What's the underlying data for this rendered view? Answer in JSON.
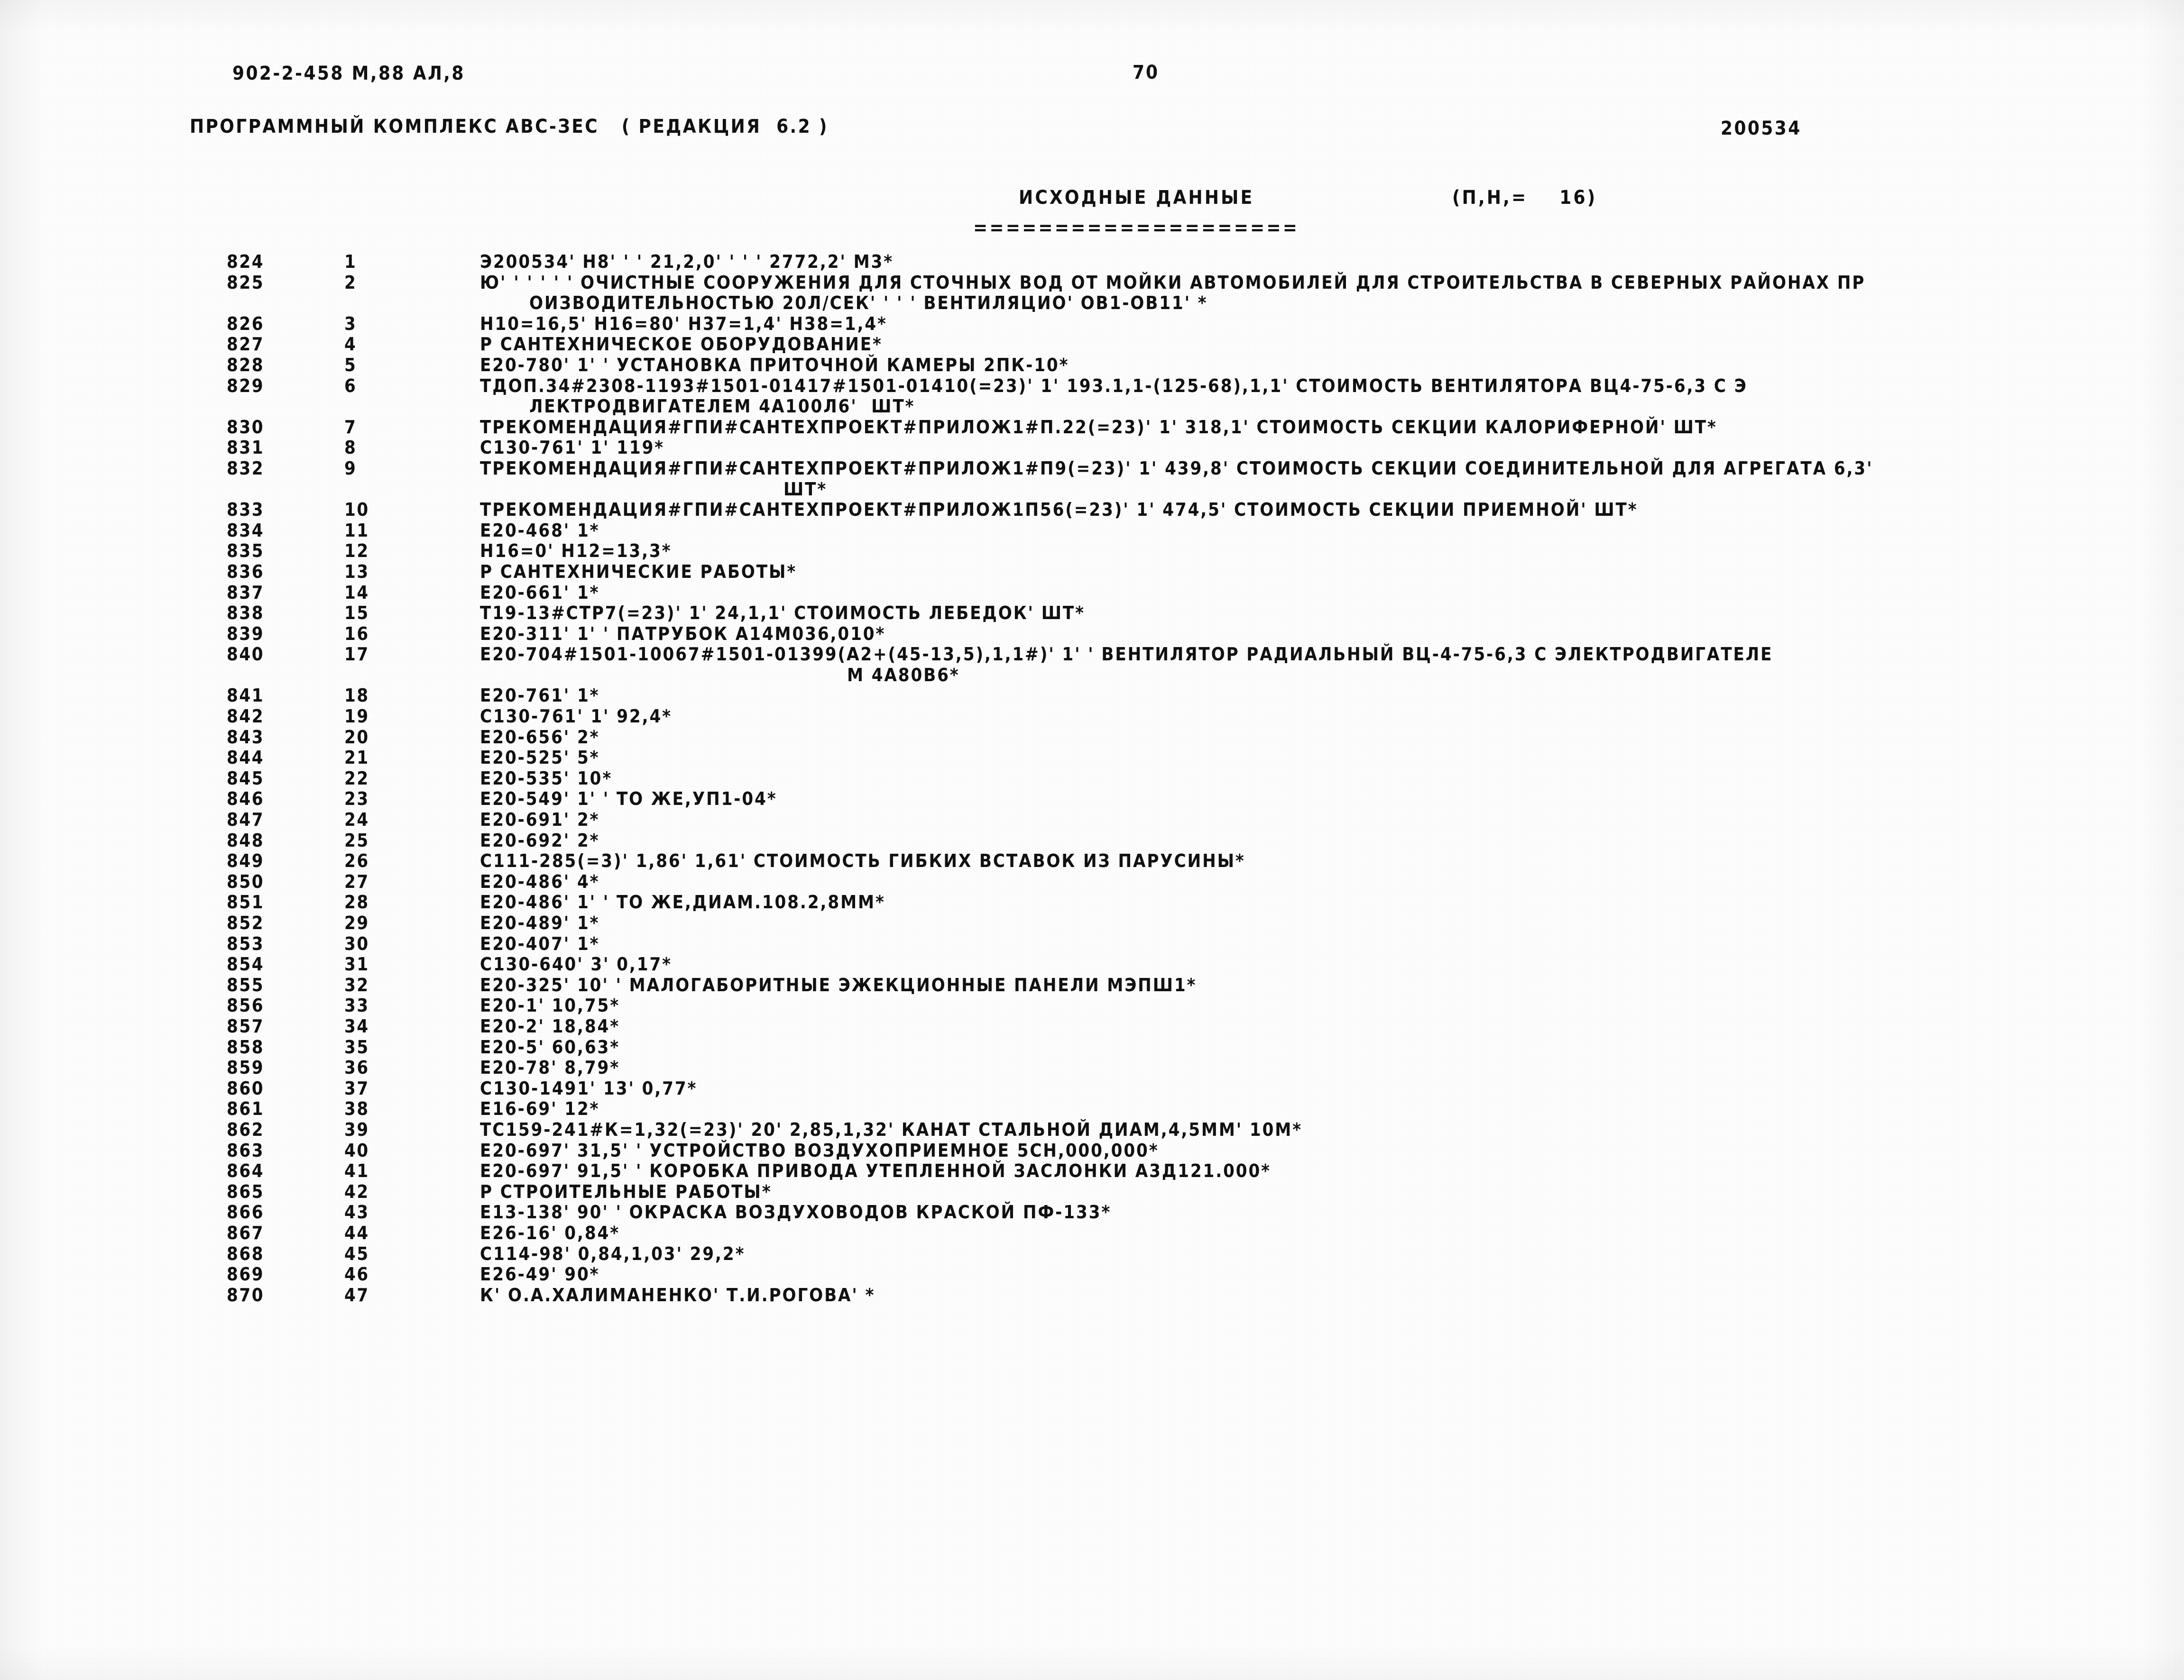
{
  "header": {
    "doc_code": "902-2-458 М,88 АЛ,8",
    "page_number": "70",
    "program_line": "ПРОГРАММНЫЙ КОМПЛЕКС АВС-ЗЕС   ( РЕДАКЦИЯ  6.2 )",
    "sheet_code": "200534"
  },
  "title": {
    "main": "ИСХОДНЫЕ ДАННЫЕ",
    "pn": "(П,Н,=    16)",
    "rule": "===================="
  },
  "listing": {
    "rows": [
      {
        "rec": "824",
        "seq": "1",
        "text": "Э200534' Н8' ' ' 21,2,0' ' ' ' 2772,2' М3*"
      },
      {
        "rec": "825",
        "seq": "2",
        "text": "Ю' ' ' ' ' ' ОЧИСТНЫЕ СООРУЖЕНИЯ ДЛЯ СТОЧНЫХ ВОД ОТ МОЙКИ АВТОМОБИЛЕЙ ДЛЯ СТРОИТЕЛЬСТВА В СЕВЕРНЫХ РАЙОНАХ ПР",
        "cont": "ОИЗВОДИТЕЛЬНОСТЬЮ 20Л/СЕК' ' ' ' ВЕНТИЛЯЦИО' ОВ1-ОВ11' *",
        "cont_indent": "ind-1"
      },
      {
        "rec": "826",
        "seq": "3",
        "text": "Н10=16,5' Н16=80' Н37=1,4' Н38=1,4*"
      },
      {
        "rec": "827",
        "seq": "4",
        "text": "Р САНТЕХНИЧЕСКОЕ ОБОРУДОВАНИЕ*"
      },
      {
        "rec": "828",
        "seq": "5",
        "text": "Е20-780' 1' ' УСТАНОВКА ПРИТОЧНОЙ КАМЕРЫ 2ПК-10*"
      },
      {
        "rec": "829",
        "seq": "6",
        "text": "ТДОП.34#2308-1193#1501-01417#1501-01410(=23)' 1' 193.1,1-(125-68),1,1' СТОИМОСТЬ ВЕНТИЛЯТОРА ВЦ4-75-6,3 С Э",
        "cont": "ЛЕКТРОДВИГАТЕЛЕМ 4А100Л6'  ШТ*",
        "cont_indent": "ind-1"
      },
      {
        "rec": "830",
        "seq": "7",
        "text": "ТРЕКОМЕНДАЦИЯ#ГПИ#САНТЕХПРОЕКТ#ПРИЛОЖ1#П.22(=23)' 1' 318,1' СТОИМОСТЬ СЕКЦИИ КАЛОРИФЕРНОЙ' ШТ*"
      },
      {
        "rec": "831",
        "seq": "8",
        "text": "С130-761' 1' 119*"
      },
      {
        "rec": "832",
        "seq": "9",
        "text": "ТРЕКОМЕНДАЦИЯ#ГПИ#САНТЕХПРОЕКТ#ПРИЛОЖ1#П9(=23)' 1' 439,8' СТОИМОСТЬ СЕКЦИИ СОЕДИНИТЕЛЬНОЙ ДЛЯ АГРЕГАТА 6,3'",
        "cont": "ШТ*",
        "cont_indent": "ind-2"
      },
      {
        "rec": "833",
        "seq": "10",
        "text": "ТРЕКОМЕНДАЦИЯ#ГПИ#САНТЕХПРОЕКТ#ПРИЛОЖ1П56(=23)' 1' 474,5' СТОИМОСТЬ СЕКЦИИ ПРИЕМНОЙ' ШТ*"
      },
      {
        "rec": "834",
        "seq": "11",
        "text": "Е20-468' 1*"
      },
      {
        "rec": "835",
        "seq": "12",
        "text": "Н16=0' Н12=13,3*"
      },
      {
        "rec": "836",
        "seq": "13",
        "text": "Р САНТЕХНИЧЕСКИЕ РАБОТЫ*"
      },
      {
        "rec": "837",
        "seq": "14",
        "text": "Е20-661' 1*"
      },
      {
        "rec": "838",
        "seq": "15",
        "text": "Т19-13#СТР7(=23)' 1' 24,1,1' СТОИМОСТЬ ЛЕБЕДОК' ШТ*"
      },
      {
        "rec": "839",
        "seq": "16",
        "text": "Е20-311' 1' ' ПАТРУБОК А14М036,010*"
      },
      {
        "rec": "840",
        "seq": "17",
        "text": "Е20-704#1501-10067#1501-01399(А2+(45-13,5),1,1#)' 1' ' ВЕНТИЛЯТОР РАДИАЛЬНЫЙ ВЦ-4-75-6,3 С ЭЛЕКТРОДВИГАТЕЛЕ",
        "cont": "М 4А80В6*",
        "cont_indent": "ind-3"
      },
      {
        "rec": "841",
        "seq": "18",
        "text": "Е20-761' 1*"
      },
      {
        "rec": "842",
        "seq": "19",
        "text": "С130-761' 1' 92,4*"
      },
      {
        "rec": "843",
        "seq": "20",
        "text": "Е20-656' 2*"
      },
      {
        "rec": "844",
        "seq": "21",
        "text": "Е20-525' 5*"
      },
      {
        "rec": "845",
        "seq": "22",
        "text": "Е20-535' 10*"
      },
      {
        "rec": "846",
        "seq": "23",
        "text": "Е20-549' 1' ' ТО ЖЕ,УП1-04*"
      },
      {
        "rec": "847",
        "seq": "24",
        "text": "Е20-691' 2*"
      },
      {
        "rec": "848",
        "seq": "25",
        "text": "Е20-692' 2*"
      },
      {
        "rec": "849",
        "seq": "26",
        "text": "С111-285(=3)' 1,86' 1,61' СТОИМОСТЬ ГИБКИХ ВСТАВОК ИЗ ПАРУСИНЫ*"
      },
      {
        "rec": "850",
        "seq": "27",
        "text": "Е20-486' 4*"
      },
      {
        "rec": "851",
        "seq": "28",
        "text": "Е20-486' 1' ' ТО ЖЕ,ДИАМ.108.2,8ММ*"
      },
      {
        "rec": "852",
        "seq": "29",
        "text": "Е20-489' 1*"
      },
      {
        "rec": "853",
        "seq": "30",
        "text": "Е20-407' 1*"
      },
      {
        "rec": "854",
        "seq": "31",
        "text": "С130-640' 3' 0,17*"
      },
      {
        "rec": "855",
        "seq": "32",
        "text": "Е20-325' 10' ' МАЛОГАБОРИТНЫЕ ЭЖЕКЦИОННЫЕ ПАНЕЛИ МЭПШ1*"
      },
      {
        "rec": "856",
        "seq": "33",
        "text": "Е20-1' 10,75*"
      },
      {
        "rec": "857",
        "seq": "34",
        "text": "Е20-2' 18,84*"
      },
      {
        "rec": "858",
        "seq": "35",
        "text": "Е20-5' 60,63*"
      },
      {
        "rec": "859",
        "seq": "36",
        "text": "Е20-78' 8,79*"
      },
      {
        "rec": "860",
        "seq": "37",
        "text": "С130-1491' 13' 0,77*"
      },
      {
        "rec": "861",
        "seq": "38",
        "text": "Е16-69' 12*"
      },
      {
        "rec": "862",
        "seq": "39",
        "text": "ТС159-241#К=1,32(=23)' 20' 2,85,1,32' КАНАТ СТАЛЬНОЙ ДИАМ,4,5ММ' 10М*"
      },
      {
        "rec": "863",
        "seq": "40",
        "text": "Е20-697' 31,5' ' УСТРОЙСТВО ВОЗДУХОПРИЕМНОЕ 5СН,000,000*"
      },
      {
        "rec": "864",
        "seq": "41",
        "text": "Е20-697' 91,5' ' КОРОБКА ПРИВОДА УТЕПЛЕННОЙ ЗАСЛОНКИ А3Д121.000*"
      },
      {
        "rec": "865",
        "seq": "42",
        "text": "Р СТРОИТЕЛЬНЫЕ РАБОТЫ*"
      },
      {
        "rec": "866",
        "seq": "43",
        "text": "Е13-138' 90' ' ОКРАСКА ВОЗДУХОВОДОВ КРАСКОЙ ПФ-133*"
      },
      {
        "rec": "867",
        "seq": "44",
        "text": "Е26-16' 0,84*"
      },
      {
        "rec": "868",
        "seq": "45",
        "text": "С114-98' 0,84,1,03' 29,2*"
      },
      {
        "rec": "869",
        "seq": "46",
        "text": "Е26-49' 90*"
      },
      {
        "rec": "870",
        "seq": "47",
        "text": "К' О.А.ХАЛИМАНЕНКО' Т.И.РОГОВА' *"
      }
    ]
  }
}
